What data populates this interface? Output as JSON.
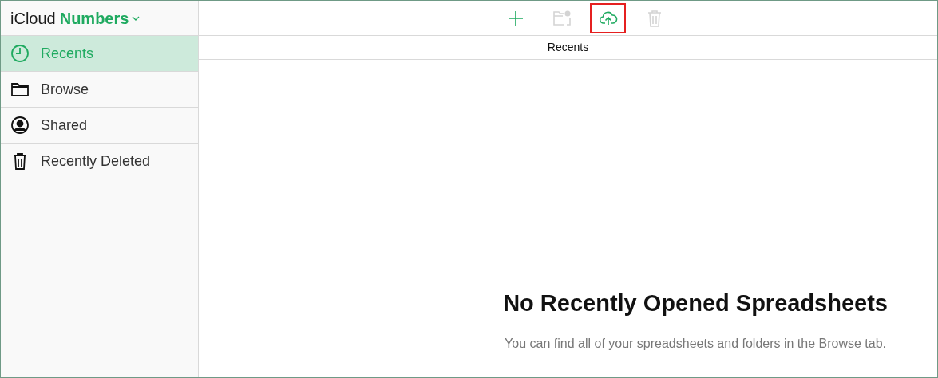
{
  "app": {
    "brand": "iCloud",
    "name": "Numbers"
  },
  "sidebar": {
    "items": [
      {
        "kind": "clock",
        "label": "Recents",
        "selected": true
      },
      {
        "kind": "folder",
        "label": "Browse",
        "selected": false
      },
      {
        "kind": "person",
        "label": "Shared",
        "selected": false
      },
      {
        "kind": "trash",
        "label": "Recently Deleted",
        "selected": false
      }
    ]
  },
  "toolbar": [
    {
      "kind": "add",
      "disabled": false,
      "highlighted": false
    },
    {
      "kind": "new-folder",
      "disabled": true,
      "highlighted": false
    },
    {
      "kind": "upload",
      "disabled": false,
      "highlighted": true
    },
    {
      "kind": "trash",
      "disabled": true,
      "highlighted": false
    }
  ],
  "section_title": "Recents",
  "empty_state": {
    "title": "No Recently Opened Spreadsheets",
    "message": "You can find all of your spreadsheets and folders in the Browse tab."
  }
}
